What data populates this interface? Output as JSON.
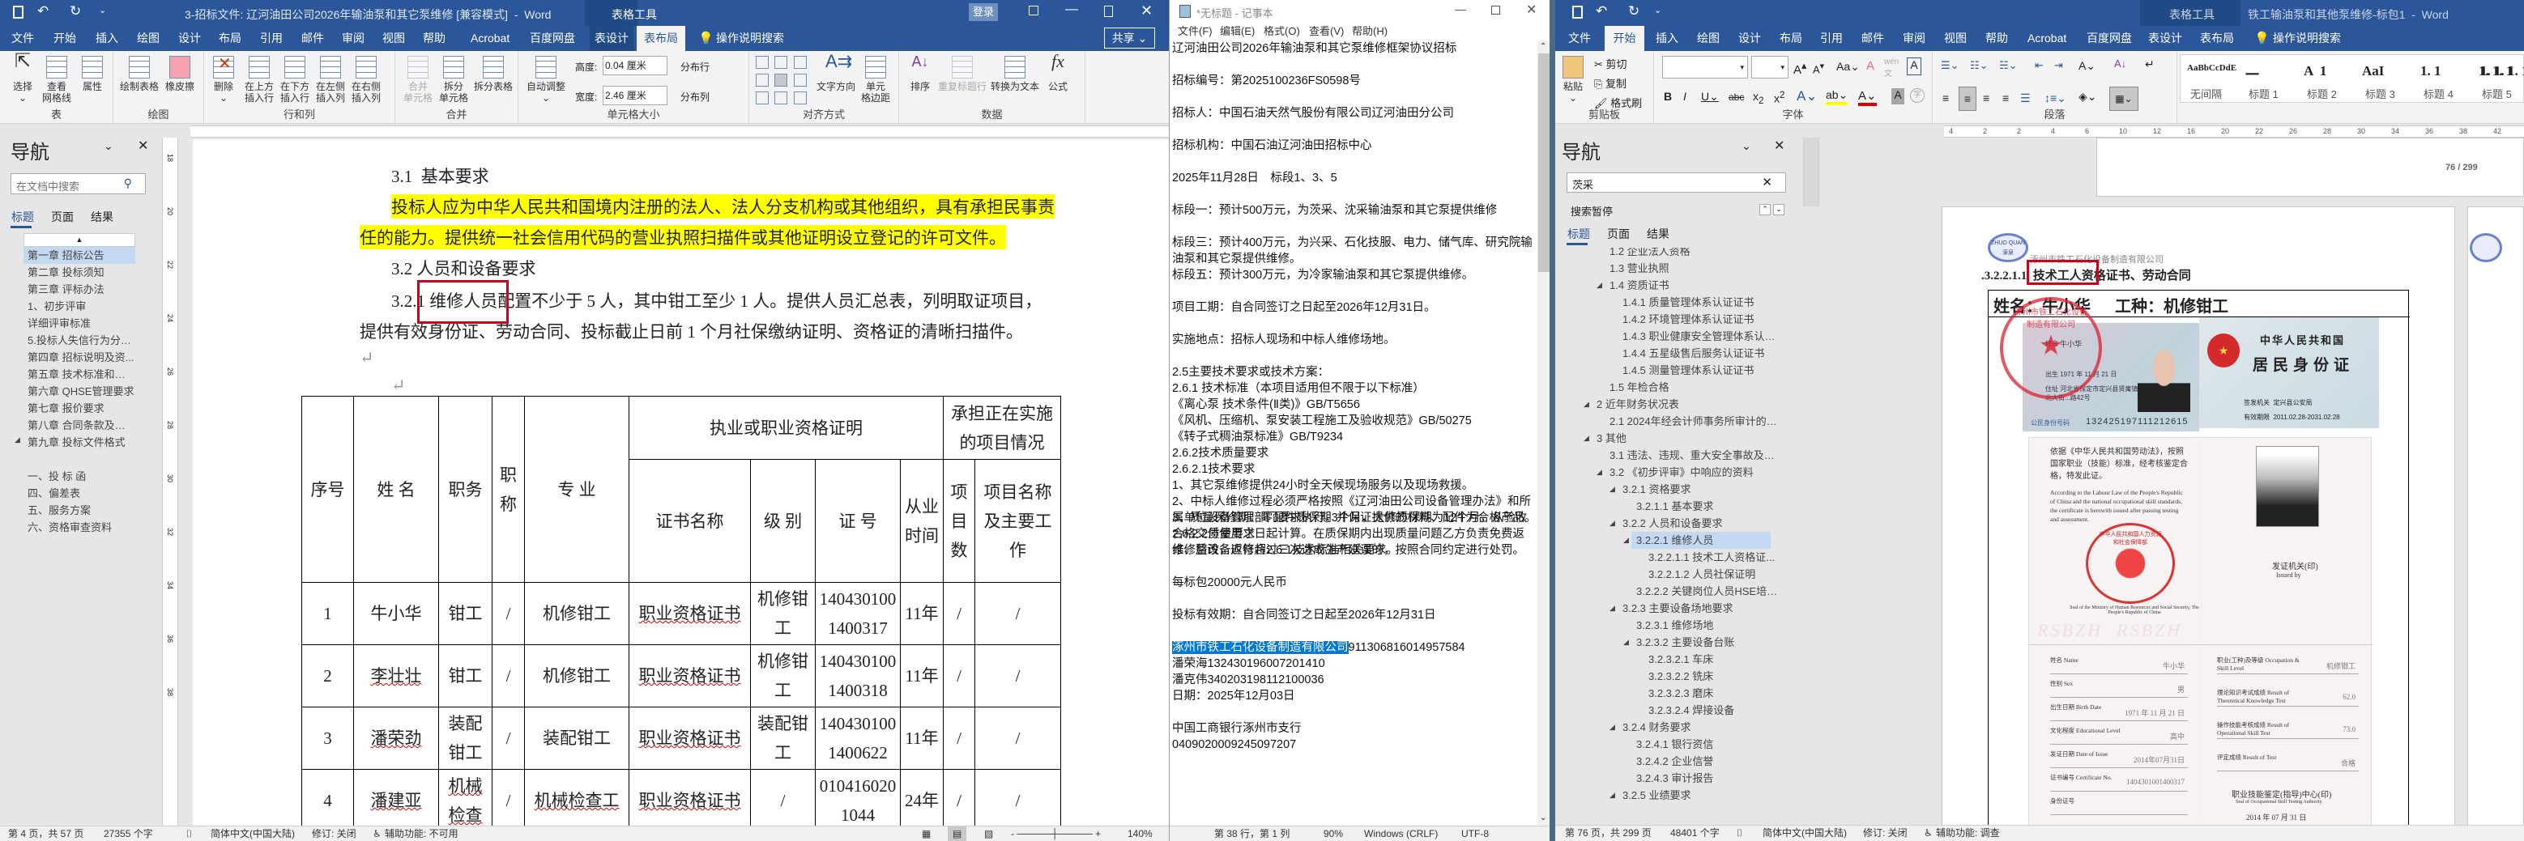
{
  "left_word": {
    "title": "3-招标文件: 辽河油田公司2026年输油泵和其它泵维修 [兼容模式]  -  Word",
    "context_group": "表格工具",
    "login": "登录",
    "share": "共享",
    "tell_me": "操作说明搜索",
    "tabs": [
      "文件",
      "开始",
      "插入",
      "绘图",
      "设计",
      "布局",
      "引用",
      "邮件",
      "审阅",
      "视图",
      "帮助",
      "Acrobat",
      "百度网盘",
      "表设计",
      "表布局"
    ],
    "ribbon": {
      "groups": [
        "表",
        "绘图",
        "行和列",
        "合并",
        "单元格大小",
        "对齐方式",
        "数据"
      ],
      "select": "选择",
      "view_gridlines": "查看\n网格线",
      "properties": "属性",
      "draw_table": "绘制表格",
      "eraser": "橡皮擦",
      "delete": "删除",
      "insert_above": "在上方\n插入行",
      "insert_below": "在下方\n插入行",
      "insert_left": "在左侧\n插入列",
      "insert_right": "在右侧\n插入列",
      "merge_cells": "合并\n单元格",
      "split_cells": "拆分\n单元格",
      "split_table": "拆分表格",
      "autofit": "自动调整",
      "height_label": "高度:",
      "height_value": "0.04 厘米",
      "width_label": "宽度:",
      "width_value": "2.46 厘米",
      "distribute_rows": "分布行",
      "distribute_cols": "分布列",
      "text_direction": "文字方向",
      "cell_margins": "单元\n格边距",
      "sort": "排序",
      "repeat_header": "重复标题行",
      "convert_to_text": "转换为文本",
      "formula": "公式"
    },
    "nav": {
      "title": "导航",
      "search_placeholder": "在文档中搜索",
      "tabs": [
        "标题",
        "页面",
        "结果"
      ],
      "items": [
        "第一章  招标公告",
        "第二章  投标须知",
        "第三章  评标办法",
        "1、初步评审",
        "详细评审标准",
        "5.投标人失信行为分级...",
        "第四章  招标说明及资...",
        "第五章  技术标准和要求",
        "第六章  QHSE管理要求",
        "第七章  报价要求",
        "第八章  合同条款及格式",
        "第九章  投标文件格式"
      ],
      "sub_items": [
        "一、投 标 函",
        "四、偏差表",
        "五、服务方案",
        "六、资格审查资料"
      ]
    },
    "doc": {
      "h31": "3.1  基本要求",
      "para1_line1": "投标人应为中华人民共和国境内注册的法人、法人分支机构或其他组织，具有承担民事责",
      "para1_line2": "任的能力。提供统一社会信用代码的营业执照扫描件或其他证明设立登记的许可文件。",
      "h32": "3.2 人员和设备要求",
      "para2_line1": "3.2.1 维修人员配置不少于 5 人，其中钳工至少 1 人。提供人员汇总表，列明取证项目，",
      "para2_line2": "提供有效身份证、劳动合同、投标截止日前 1 个月社保缴纳证明、资格证的清晰扫描件。"
    },
    "table": {
      "headers": {
        "no": "序号",
        "name": "姓 名",
        "duty": "职务",
        "title": "职称",
        "major": "专 业",
        "cert_group": "执业或职业资格证明",
        "project_group": "承担正在实施的项目情况",
        "cert_name": "证书名称",
        "level": "级 别",
        "cert_no": "证 号",
        "years": "从业时间",
        "proj_count": "项目数",
        "proj_name": "项目名称及主要工作"
      },
      "rows": [
        {
          "no": "1",
          "name": "牛小华",
          "duty": "钳工",
          "title": "/",
          "major": "机修钳工",
          "cert_name": "职业资格证书",
          "level": "机修钳工",
          "cert_no": "1404301001400317",
          "years": "11年",
          "proj_count": "/",
          "proj_name": "/"
        },
        {
          "no": "2",
          "name": "李壮壮",
          "duty": "钳工",
          "title": "/",
          "major": "机修钳工",
          "cert_name": "职业资格证书",
          "level": "机修钳工",
          "cert_no": "1404301001400318",
          "years": "11年",
          "proj_count": "/",
          "proj_name": "/"
        },
        {
          "no": "3",
          "name": "潘荣劲",
          "duty": "装配钳工",
          "title": "/",
          "major": "装配钳工",
          "cert_name": "职业资格证书",
          "level": "装配钳工",
          "cert_no": "1404301001400622",
          "years": "11年",
          "proj_count": "/",
          "proj_name": "/"
        },
        {
          "no": "4",
          "name": "潘建亚",
          "duty": "机械检查",
          "title": "/",
          "major": "机械检查工",
          "cert_name": "职业资格证书",
          "level": "/",
          "cert_no": "0104160201044",
          "years": "24年",
          "proj_count": "/",
          "proj_name": "/"
        }
      ]
    },
    "status": {
      "page": "第 4 页，共 57 页",
      "words": "27355 个字",
      "lang": "简体中文(中国大陆)",
      "track": "修订: 关闭",
      "accessibility": "辅助功能: 不可用",
      "zoom": "140%"
    },
    "ruler_numbers": [
      "18",
      "20",
      "22",
      "24",
      "26",
      "28",
      "30",
      "32",
      "34",
      "36",
      "38"
    ]
  },
  "notepad": {
    "title": "*无标题 - 记事本",
    "menu": [
      "文件(F)",
      "编辑(E)",
      "格式(O)",
      "查看(V)",
      "帮助(H)"
    ],
    "lines": [
      "辽河油田公司2026年输油泵和其它泵维修框架协议招标",
      "",
      "招标编号：第2025100236FS0598号",
      "",
      "招标人：中国石油天然气股份有限公司辽河油田分公司",
      "",
      "招标机构：中国石油辽河油田招标中心",
      "",
      "2025年11月28日　标段1、3、5",
      "",
      "标段一：预计500万元，为茨采、沈采输油泵和其它泵提供维修",
      "",
      "标段三：预计400万元，为兴采、石化技服、电力、储气库、研究院输油泵和其它泵提供维修。",
      "",
      "标段五：预计300万元，为冷家输油泵和其它泵提供维修。",
      "",
      "项目工期：自合同签订之日起至2026年12月31日。",
      "",
      "实施地点：招标人现场和中标人维修场地。",
      "",
      "2.5主要技术要求或技术方案：",
      "2.6.1 技术标准（本项目适用但不限于以下标准）",
      "《离心泵 技术条件(Ⅱ类)》GB/T5656",
      "《风机、压缩机、泵安装工程施工及验收规范》GB/50275",
      "《转子式稠油泵标准》GB/T9234",
      "2.6.2技术质量要求",
      "2.6.2.1技术要求",
      "1、其它泵维修提供24小时全天候现场服务以及现场救援。",
      "2、中标人维修过程必须严格按照《辽河油田公司设备管理办法》和所属单位设备管理部门要求执行，并保证提供的材料、配件为合格产品。",
      "3、质量保修期：零配件质保期3个月，大修质保期为12个月，从验收合格交付使用之日起计算。在质保期内出现质量问题乙方负责免费返修、整改，返修超过三次造成生产延误的，按照合同约定进行处罚。",
      "2.6.2.2质量要求",
      "维修后设备应符合2.6.1技术标准相关要求。",
      "",
      "每标包20000元人民币",
      "",
      "投标有效期：自合同签订之日起至2026年12月31日",
      ""
    ],
    "selected_company": "涿州市铁工石化设备制造有限公司",
    "company_code": "911306816014957584",
    "after_lines": [
      "潘荣海132430196007201410",
      "潘克伟340203198112100036",
      "日期：2025年12月03日",
      "",
      "中国工商银行涿州市支行",
      "0409020009245097207"
    ],
    "status": {
      "position": "第 38 行，第 1 列",
      "zoom": "90%",
      "eol": "Windows (CRLF)",
      "encoding": "UTF-8"
    }
  },
  "right_word": {
    "title": "铁工输油泵和其他泵维修-标包1  -  Word",
    "context_group": "表格工具",
    "tell_me": "操作说明搜索",
    "tabs": [
      "文件",
      "开始",
      "插入",
      "绘图",
      "设计",
      "布局",
      "引用",
      "邮件",
      "审阅",
      "视图",
      "帮助",
      "Acrobat",
      "百度网盘",
      "表设计",
      "表布局"
    ],
    "ribbon": {
      "groups": [
        "剪贴板",
        "字体",
        "段落"
      ],
      "paste": "粘贴",
      "cut": "剪切",
      "copy": "复制",
      "format_painter": "格式刷",
      "styles": [
        {
          "sample": "AaBbCcDdE",
          "label": "无间隔"
        },
        {
          "sample": "一",
          "label": "标题 1"
        },
        {
          "sample": "A  1",
          "label": "标题 2"
        },
        {
          "sample": "AaI",
          "label": "标题 3"
        },
        {
          "sample": "1. 1",
          "label": "标题 4"
        },
        {
          "sample": "1. 1. 1",
          "label": "标题 5"
        }
      ],
      "extra_style_sample": "1. 1. 1. 1"
    },
    "nav": {
      "title": "导航",
      "search_value": "茨采",
      "search_status": "搜索暂停",
      "tabs": [
        "标题",
        "页面",
        "结果"
      ],
      "items": [
        {
          "text": "1.2 企业法人资格",
          "level": 1
        },
        {
          "text": "1.3 营业执照",
          "level": 1
        },
        {
          "text": "1.4 资质证书",
          "level": 1,
          "expanded": true
        },
        {
          "text": "1.4.1 质量管理体系认证证书",
          "level": 2
        },
        {
          "text": "1.4.2 环境管理体系认证证书",
          "level": 2
        },
        {
          "text": "1.4.3 职业健康安全管理体系认证...",
          "level": 2
        },
        {
          "text": "1.4.4 五星级售后服务认证证书",
          "level": 2
        },
        {
          "text": "1.4.5 测量管理体系认证证书",
          "level": 2
        },
        {
          "text": "1.5 年检合格",
          "level": 1
        },
        {
          "text": "2 近年财务状况表",
          "level": 0,
          "expanded": true
        },
        {
          "text": "2.1 2024年经会计师事务所审计的财...",
          "level": 1
        },
        {
          "text": "3 其他",
          "level": 0,
          "expanded": true
        },
        {
          "text": "3.1 违法、违规、重大安全事故及其...",
          "level": 1
        },
        {
          "text": "3.2 《初步评审》中响应的资料",
          "level": 1,
          "expanded": true
        },
        {
          "text": "3.2.1 资格要求",
          "level": 2,
          "expanded": true
        },
        {
          "text": "3.2.1.1 基本要求",
          "level": 3
        },
        {
          "text": "3.2.2 人员和设备要求",
          "level": 2,
          "expanded": true
        },
        {
          "text": "3.2.2.1 维修人员",
          "level": 3,
          "expanded": true,
          "selected": true
        },
        {
          "text": "3.2.2.1.1 技术工人资格证...",
          "level": 4
        },
        {
          "text": "3.2.2.1.2 人员社保证明",
          "level": 4
        },
        {
          "text": "3.2.2.2 关键岗位人员HSE培训...",
          "level": 3
        },
        {
          "text": "3.2.3 主要设备场地要求",
          "level": 2,
          "expanded": true
        },
        {
          "text": "3.2.3.1 维修场地",
          "level": 3
        },
        {
          "text": "3.2.3.2 主要设备台账",
          "level": 3,
          "expanded": true
        },
        {
          "text": "3.2.3.2.1 车床",
          "level": 4
        },
        {
          "text": "3.2.3.2.2 铣床",
          "level": 4
        },
        {
          "text": "3.2.3.2.3 磨床",
          "level": 4
        },
        {
          "text": "3.2.3.2.4 焊接设备",
          "level": 4
        },
        {
          "text": "3.2.4 财务要求",
          "level": 2,
          "expanded": true
        },
        {
          "text": "3.2.4.1 银行资信",
          "level": 3
        },
        {
          "text": "3.2.4.2 企业信誉",
          "level": 3
        },
        {
          "text": "3.2.4.3 审计报告",
          "level": 3
        },
        {
          "text": "3.2.5 业绩要求",
          "level": 2,
          "expanded": true
        }
      ]
    },
    "page_counter": "76 / 299",
    "doc": {
      "header_company": "涿州市铁工石化设备制造有限公司",
      "logo_text": "ZHUO QUAN 涿泉",
      "heading": ".3.2.2.1.1  技术工人资格证书、劳动合同",
      "name_row": "姓名：牛小华      工种：机修钳工",
      "id_front": {
        "name_label": "姓名",
        "name": "牛小华",
        "birth": "出生 1971 年 11 月 21 日",
        "address": "住址 河北省保定市定兴县贤寓镇北大街...路42号",
        "id_label": "公民身份号码",
        "id_number": "132425197111212615"
      },
      "id_back": {
        "country": "中华人民共和国",
        "title": "居民身份证",
        "authority": "签发机关  定兴县公安局",
        "validity": "有效期限  2011.02.28-2031.02.28"
      },
      "stamp_company": "涿州市铁工石化设备制造有限公司",
      "cert": {
        "cn_text": "依据《中华人民共和国劳动法》，按照国家职业（技能）标准，经考核鉴定合格，特发此证。",
        "en_text": "According to the Labour Law of the People's Republic of China and the national occupational skill standards, the certificate is herewith issued after passing testing and assessment.",
        "ministry_seal": "中华人民共和国人力资源和社会保障部",
        "ministry_seal_en": "Seal of the Ministry of Human Resources and Social Security, The People's Republic of China",
        "issued_by": "发证机关(印)",
        "issued_by_en": "Issued by",
        "watermark": "RSBZH  RSBZH",
        "fields_left": [
          {
            "label": "姓名 Name",
            "value": "牛小华"
          },
          {
            "label": "性别 Sex",
            "value": "男"
          },
          {
            "label": "出生日期 Birth Date",
            "value": "1971 年 11 月 21 日"
          },
          {
            "label": "文化程度 Educational Level",
            "value": "高中"
          },
          {
            "label": "发证日期 Date of Issue",
            "value": "2014年07月31日"
          },
          {
            "label": "证书编号 Certificate No.",
            "value": "1404301001400317"
          },
          {
            "label": "身份证号",
            "value": ""
          }
        ],
        "fields_right": [
          {
            "label": "职业(工种)及等级 Occupation & Skill Level",
            "value": "机修钳工"
          },
          {
            "label": "理论知识考试成绩 Result of Theoretical Knowledge Test",
            "value": "62.0"
          },
          {
            "label": "操作技能考核成绩 Result of Operational Skill Test",
            "value": "73.0"
          },
          {
            "label": "评定成绩 Result of Test",
            "value": "合格"
          }
        ],
        "center_seal": "职业技能鉴定(指导)中心(印)",
        "center_seal_en": "Seal of Occupational Skill Testing Authority",
        "center_date": "2014 年 07 月 31 日"
      }
    },
    "status": {
      "page": "第 76 页，共 299 页",
      "words": "48401 个字",
      "lang": "简体中文(中国大陆)",
      "track": "修订: 关闭",
      "accessibility": "辅助功能: 调查"
    },
    "ruler_numbers": [
      "4",
      "2",
      "2",
      "4",
      "6",
      "10",
      "12",
      "16",
      "20",
      "22",
      "26",
      "28",
      "30",
      "34",
      "36",
      "38",
      "42"
    ]
  },
  "colors": {
    "word_blue": "#2b579a",
    "highlight": "#ffff00",
    "selection": "#0078d7",
    "annotation_red": "#d0021b",
    "nav_selected": "#c5d8f1"
  }
}
